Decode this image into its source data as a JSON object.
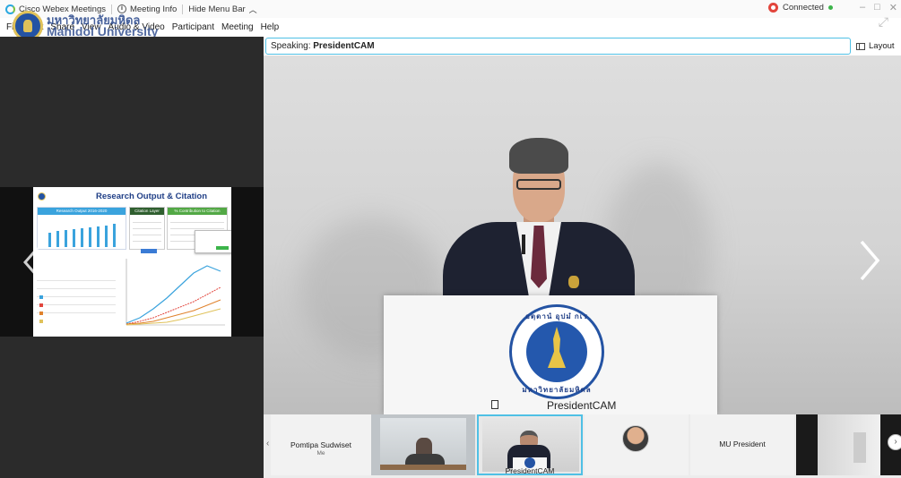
{
  "titlebar": {
    "app_name": "Cisco Webex Meetings",
    "meeting_info": "Meeting Info",
    "hide_menu_bar": "Hide Menu Bar",
    "status": "Connected"
  },
  "menubar": {
    "items": [
      "File",
      "Edit",
      "Share",
      "View",
      "Audio & Video",
      "Participant",
      "Meeting",
      "Help"
    ]
  },
  "watermark": {
    "thai": "มหาวิทยาลัยมหิดล",
    "english": "Mahidol University"
  },
  "shared_slide": {
    "title": "Research Output & Citation",
    "panel_a_header": "Research Output 2016-2020",
    "panel_b_header": "Citation Layer",
    "panel_c_header": "% Contribution to Citation"
  },
  "speaker": {
    "label": "Speaking:",
    "name": "PresidentCAM"
  },
  "layout_button": "Layout",
  "stage": {
    "name_label": "PresidentCAM",
    "podium_seal_top": "อตฺตานํ อุปมํ กเร",
    "podium_seal_bottom": "มหาวิทยาลัยมหิดล"
  },
  "filmstrip": {
    "tiles": [
      {
        "name": "Pomtipa Sudwiset",
        "sub": "Me"
      },
      {
        "name": ""
      },
      {
        "name": "PresidentCAM"
      },
      {
        "name": ""
      },
      {
        "name": "MU President"
      },
      {
        "name": ""
      }
    ]
  },
  "colors": {
    "accent": "#4fc0e5",
    "mahidol_blue": "#2453a3",
    "record_red": "#e2453c",
    "connected_green": "#3cb44a"
  },
  "icons": [
    "webex-logo-icon",
    "info-icon",
    "chevron-up-icon",
    "record-icon",
    "minimize-icon",
    "maximize-icon",
    "close-icon",
    "popout-icon",
    "layout-icon",
    "chevron-left-icon",
    "chevron-right-icon",
    "camera-icon"
  ]
}
